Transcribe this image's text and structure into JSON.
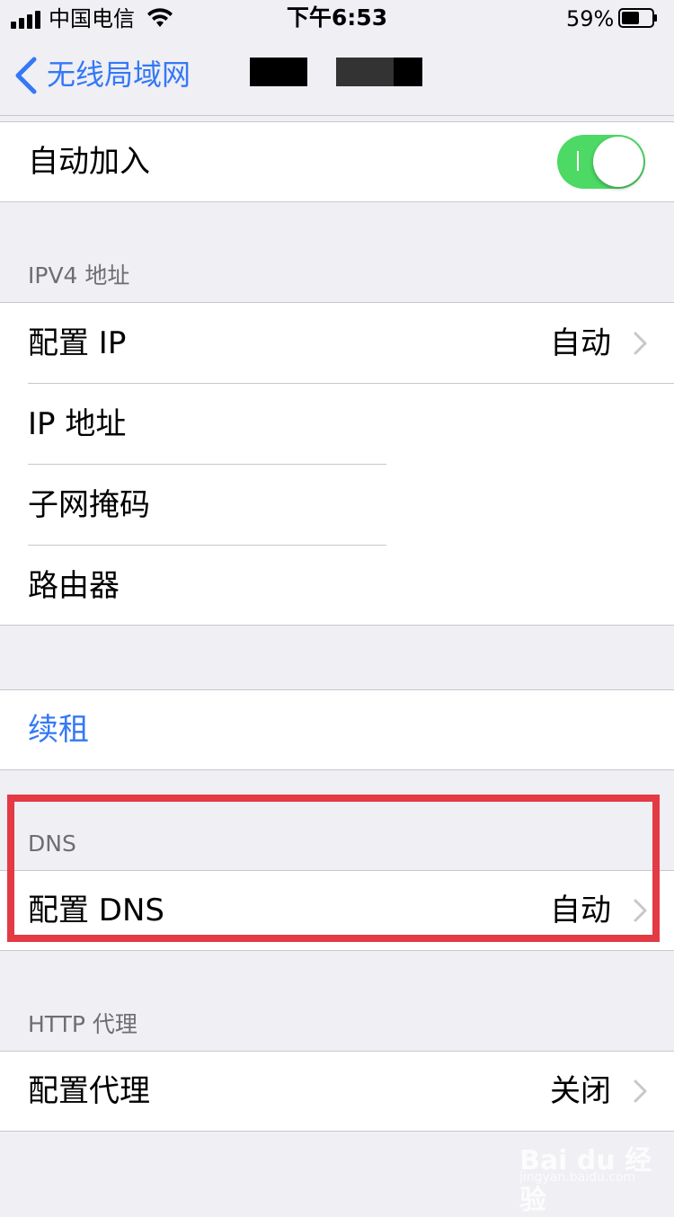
{
  "status_bar": {
    "carrier": "中国电信",
    "time": "下午6:53",
    "battery_percent": "59%",
    "battery_level": 0.59,
    "signal_bars": 4
  },
  "nav": {
    "back_label": "无线局域网"
  },
  "auto_join": {
    "label": "自动加入",
    "enabled": true
  },
  "ipv4": {
    "header": "IPV4 地址",
    "rows": [
      {
        "label": "配置 IP",
        "value": "自动"
      },
      {
        "label": "IP 地址",
        "value": ""
      },
      {
        "label": "子网掩码",
        "value": ""
      },
      {
        "label": "路由器",
        "value": ""
      }
    ]
  },
  "renew": {
    "label": "续租"
  },
  "dns": {
    "header": "DNS",
    "row_label": "配置 DNS",
    "row_value": "自动"
  },
  "http_proxy": {
    "header": "HTTP 代理",
    "row_label": "配置代理",
    "row_value": "关闭"
  },
  "watermark": {
    "text": "Bai du 经验",
    "sub": "jingyan.baidu.com"
  },
  "colors": {
    "accent": "#3478f6",
    "toggle_on": "#4cd964",
    "highlight": "#e33a44",
    "background": "#efeff4"
  }
}
